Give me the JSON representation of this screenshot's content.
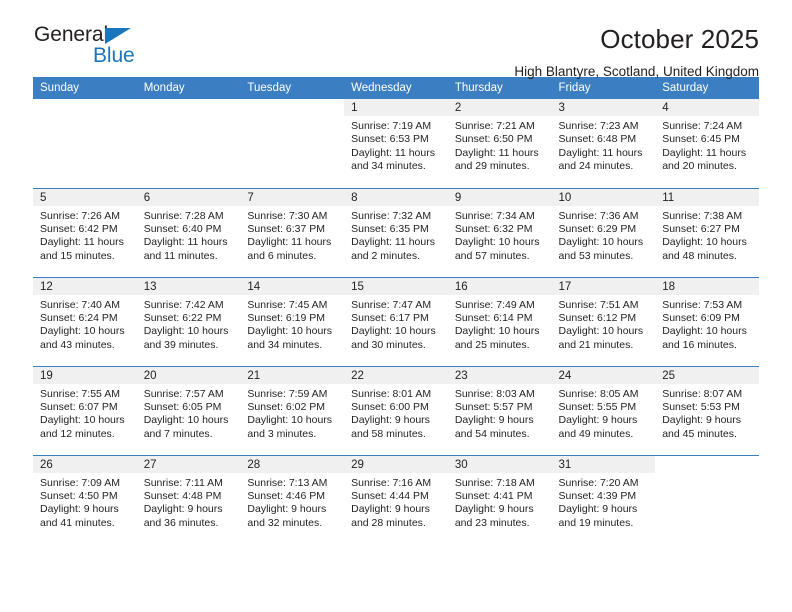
{
  "brand": {
    "name_dark": "General",
    "name_blue": "Blue",
    "accent_color": "#1b75bb",
    "header_color": "#3b7ec1"
  },
  "header": {
    "title": "October 2025",
    "subtitle": "High Blantyre, Scotland, United Kingdom"
  },
  "weekday_headers": [
    "Sunday",
    "Monday",
    "Tuesday",
    "Wednesday",
    "Thursday",
    "Friday",
    "Saturday"
  ],
  "labels": {
    "sunrise_prefix": "Sunrise:",
    "sunset_prefix": "Sunset:",
    "daylight_prefix": "Daylight:"
  },
  "weeks": [
    [
      {
        "day": "",
        "blank": true
      },
      {
        "day": "",
        "blank": true
      },
      {
        "day": "",
        "blank": true
      },
      {
        "day": "1",
        "sunrise": "Sunrise: 7:19 AM",
        "sunset": "Sunset: 6:53 PM",
        "daylight1": "Daylight: 11 hours",
        "daylight2": "and 34 minutes."
      },
      {
        "day": "2",
        "sunrise": "Sunrise: 7:21 AM",
        "sunset": "Sunset: 6:50 PM",
        "daylight1": "Daylight: 11 hours",
        "daylight2": "and 29 minutes."
      },
      {
        "day": "3",
        "sunrise": "Sunrise: 7:23 AM",
        "sunset": "Sunset: 6:48 PM",
        "daylight1": "Daylight: 11 hours",
        "daylight2": "and 24 minutes."
      },
      {
        "day": "4",
        "sunrise": "Sunrise: 7:24 AM",
        "sunset": "Sunset: 6:45 PM",
        "daylight1": "Daylight: 11 hours",
        "daylight2": "and 20 minutes."
      }
    ],
    [
      {
        "day": "5",
        "sunrise": "Sunrise: 7:26 AM",
        "sunset": "Sunset: 6:42 PM",
        "daylight1": "Daylight: 11 hours",
        "daylight2": "and 15 minutes."
      },
      {
        "day": "6",
        "sunrise": "Sunrise: 7:28 AM",
        "sunset": "Sunset: 6:40 PM",
        "daylight1": "Daylight: 11 hours",
        "daylight2": "and 11 minutes."
      },
      {
        "day": "7",
        "sunrise": "Sunrise: 7:30 AM",
        "sunset": "Sunset: 6:37 PM",
        "daylight1": "Daylight: 11 hours",
        "daylight2": "and 6 minutes."
      },
      {
        "day": "8",
        "sunrise": "Sunrise: 7:32 AM",
        "sunset": "Sunset: 6:35 PM",
        "daylight1": "Daylight: 11 hours",
        "daylight2": "and 2 minutes."
      },
      {
        "day": "9",
        "sunrise": "Sunrise: 7:34 AM",
        "sunset": "Sunset: 6:32 PM",
        "daylight1": "Daylight: 10 hours",
        "daylight2": "and 57 minutes."
      },
      {
        "day": "10",
        "sunrise": "Sunrise: 7:36 AM",
        "sunset": "Sunset: 6:29 PM",
        "daylight1": "Daylight: 10 hours",
        "daylight2": "and 53 minutes."
      },
      {
        "day": "11",
        "sunrise": "Sunrise: 7:38 AM",
        "sunset": "Sunset: 6:27 PM",
        "daylight1": "Daylight: 10 hours",
        "daylight2": "and 48 minutes."
      }
    ],
    [
      {
        "day": "12",
        "sunrise": "Sunrise: 7:40 AM",
        "sunset": "Sunset: 6:24 PM",
        "daylight1": "Daylight: 10 hours",
        "daylight2": "and 43 minutes."
      },
      {
        "day": "13",
        "sunrise": "Sunrise: 7:42 AM",
        "sunset": "Sunset: 6:22 PM",
        "daylight1": "Daylight: 10 hours",
        "daylight2": "and 39 minutes."
      },
      {
        "day": "14",
        "sunrise": "Sunrise: 7:45 AM",
        "sunset": "Sunset: 6:19 PM",
        "daylight1": "Daylight: 10 hours",
        "daylight2": "and 34 minutes."
      },
      {
        "day": "15",
        "sunrise": "Sunrise: 7:47 AM",
        "sunset": "Sunset: 6:17 PM",
        "daylight1": "Daylight: 10 hours",
        "daylight2": "and 30 minutes."
      },
      {
        "day": "16",
        "sunrise": "Sunrise: 7:49 AM",
        "sunset": "Sunset: 6:14 PM",
        "daylight1": "Daylight: 10 hours",
        "daylight2": "and 25 minutes."
      },
      {
        "day": "17",
        "sunrise": "Sunrise: 7:51 AM",
        "sunset": "Sunset: 6:12 PM",
        "daylight1": "Daylight: 10 hours",
        "daylight2": "and 21 minutes."
      },
      {
        "day": "18",
        "sunrise": "Sunrise: 7:53 AM",
        "sunset": "Sunset: 6:09 PM",
        "daylight1": "Daylight: 10 hours",
        "daylight2": "and 16 minutes."
      }
    ],
    [
      {
        "day": "19",
        "sunrise": "Sunrise: 7:55 AM",
        "sunset": "Sunset: 6:07 PM",
        "daylight1": "Daylight: 10 hours",
        "daylight2": "and 12 minutes."
      },
      {
        "day": "20",
        "sunrise": "Sunrise: 7:57 AM",
        "sunset": "Sunset: 6:05 PM",
        "daylight1": "Daylight: 10 hours",
        "daylight2": "and 7 minutes."
      },
      {
        "day": "21",
        "sunrise": "Sunrise: 7:59 AM",
        "sunset": "Sunset: 6:02 PM",
        "daylight1": "Daylight: 10 hours",
        "daylight2": "and 3 minutes."
      },
      {
        "day": "22",
        "sunrise": "Sunrise: 8:01 AM",
        "sunset": "Sunset: 6:00 PM",
        "daylight1": "Daylight: 9 hours",
        "daylight2": "and 58 minutes."
      },
      {
        "day": "23",
        "sunrise": "Sunrise: 8:03 AM",
        "sunset": "Sunset: 5:57 PM",
        "daylight1": "Daylight: 9 hours",
        "daylight2": "and 54 minutes."
      },
      {
        "day": "24",
        "sunrise": "Sunrise: 8:05 AM",
        "sunset": "Sunset: 5:55 PM",
        "daylight1": "Daylight: 9 hours",
        "daylight2": "and 49 minutes."
      },
      {
        "day": "25",
        "sunrise": "Sunrise: 8:07 AM",
        "sunset": "Sunset: 5:53 PM",
        "daylight1": "Daylight: 9 hours",
        "daylight2": "and 45 minutes."
      }
    ],
    [
      {
        "day": "26",
        "sunrise": "Sunrise: 7:09 AM",
        "sunset": "Sunset: 4:50 PM",
        "daylight1": "Daylight: 9 hours",
        "daylight2": "and 41 minutes."
      },
      {
        "day": "27",
        "sunrise": "Sunrise: 7:11 AM",
        "sunset": "Sunset: 4:48 PM",
        "daylight1": "Daylight: 9 hours",
        "daylight2": "and 36 minutes."
      },
      {
        "day": "28",
        "sunrise": "Sunrise: 7:13 AM",
        "sunset": "Sunset: 4:46 PM",
        "daylight1": "Daylight: 9 hours",
        "daylight2": "and 32 minutes."
      },
      {
        "day": "29",
        "sunrise": "Sunrise: 7:16 AM",
        "sunset": "Sunset: 4:44 PM",
        "daylight1": "Daylight: 9 hours",
        "daylight2": "and 28 minutes."
      },
      {
        "day": "30",
        "sunrise": "Sunrise: 7:18 AM",
        "sunset": "Sunset: 4:41 PM",
        "daylight1": "Daylight: 9 hours",
        "daylight2": "and 23 minutes."
      },
      {
        "day": "31",
        "sunrise": "Sunrise: 7:20 AM",
        "sunset": "Sunset: 4:39 PM",
        "daylight1": "Daylight: 9 hours",
        "daylight2": "and 19 minutes."
      },
      {
        "day": "",
        "blank": true
      }
    ]
  ]
}
